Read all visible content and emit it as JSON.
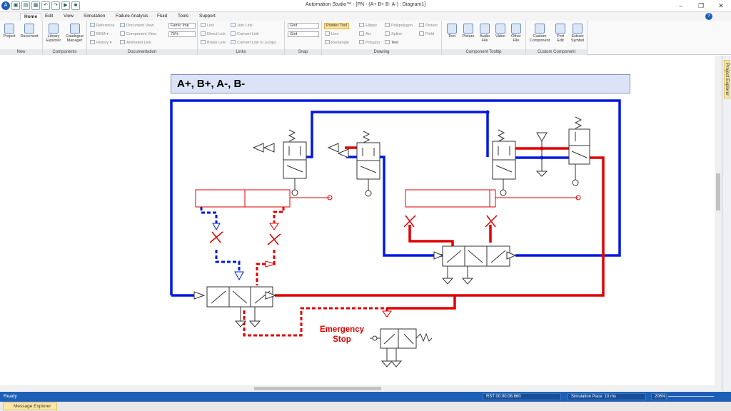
{
  "window": {
    "title": "Automation Studio™ - [PN -       (A+ B+ B- A-) : Diagram1]",
    "controls": [
      "‒",
      "❐",
      "✕"
    ]
  },
  "menu": {
    "tabs": [
      "Home",
      "Edit",
      "View",
      "Simulation",
      "Failure Analysis",
      "Fluid",
      "Tools",
      "Support"
    ],
    "active": "Home"
  },
  "ribbon": {
    "groups": {
      "new": "New",
      "components": "Components",
      "documentation": "Documentation",
      "links": "Links",
      "snap": "Snap",
      "drawing": "Drawing",
      "tooltip": "Component Tooltip",
      "custom": "Custom Component"
    },
    "new": {
      "project": "Project",
      "document": "Document"
    },
    "components": {
      "library": "Library\nExplorer",
      "catalogue": "Catalogue\nManager"
    },
    "documentation": {
      "reference": "Reference",
      "bom": "BOM",
      "history": "History",
      "document_view": "Document View",
      "component_view": "Component View",
      "animated_link": "Animated Link",
      "font_family": "Famic Imp",
      "zoom": "75%"
    },
    "links": {
      "link": "Link",
      "direct_link": "Direct Link",
      "break_link": "Break Link",
      "join_link": "Join Link",
      "convert_link": "Convert Link",
      "convert_jumps": "Convert Link to Jumps"
    },
    "snap": {
      "grid1": "Grid",
      "grid2": "Grid"
    },
    "drawing": {
      "pointer": "Pointer Tool",
      "line": "Line",
      "rectangle": "Rectangle",
      "ellipse": "Ellipse",
      "arc": "Arc",
      "polygon": "Polygon",
      "polypolygon": "Polypolygon",
      "spline": "Spline",
      "text": "Text",
      "picture": "Picture",
      "field": "Field"
    },
    "tooltip": {
      "text": "Text",
      "picture": "Picture",
      "audio": "Audio\nFile",
      "video": "Video",
      "other": "Other\nFile"
    },
    "custom": {
      "custom": "Custom\nComponent",
      "port": "Port\nEdit",
      "extract": "Extract\nSymbol"
    }
  },
  "diagram": {
    "title": "A+, B+, A-, B-",
    "emergency_label_1": "Emergency",
    "emergency_label_2": "Stop",
    "colors": {
      "pressure": "#e00000",
      "exhaust": "#0018e0",
      "line": "#333333"
    }
  },
  "side_panel": {
    "label": "Project Explorer"
  },
  "status": {
    "ready": "Ready",
    "rst": "RST 00:00:08.660",
    "pace": "Simulation Pace: 10 ms",
    "zoom": "206%"
  },
  "bottom": {
    "message_explorer": "Message Explorer"
  }
}
